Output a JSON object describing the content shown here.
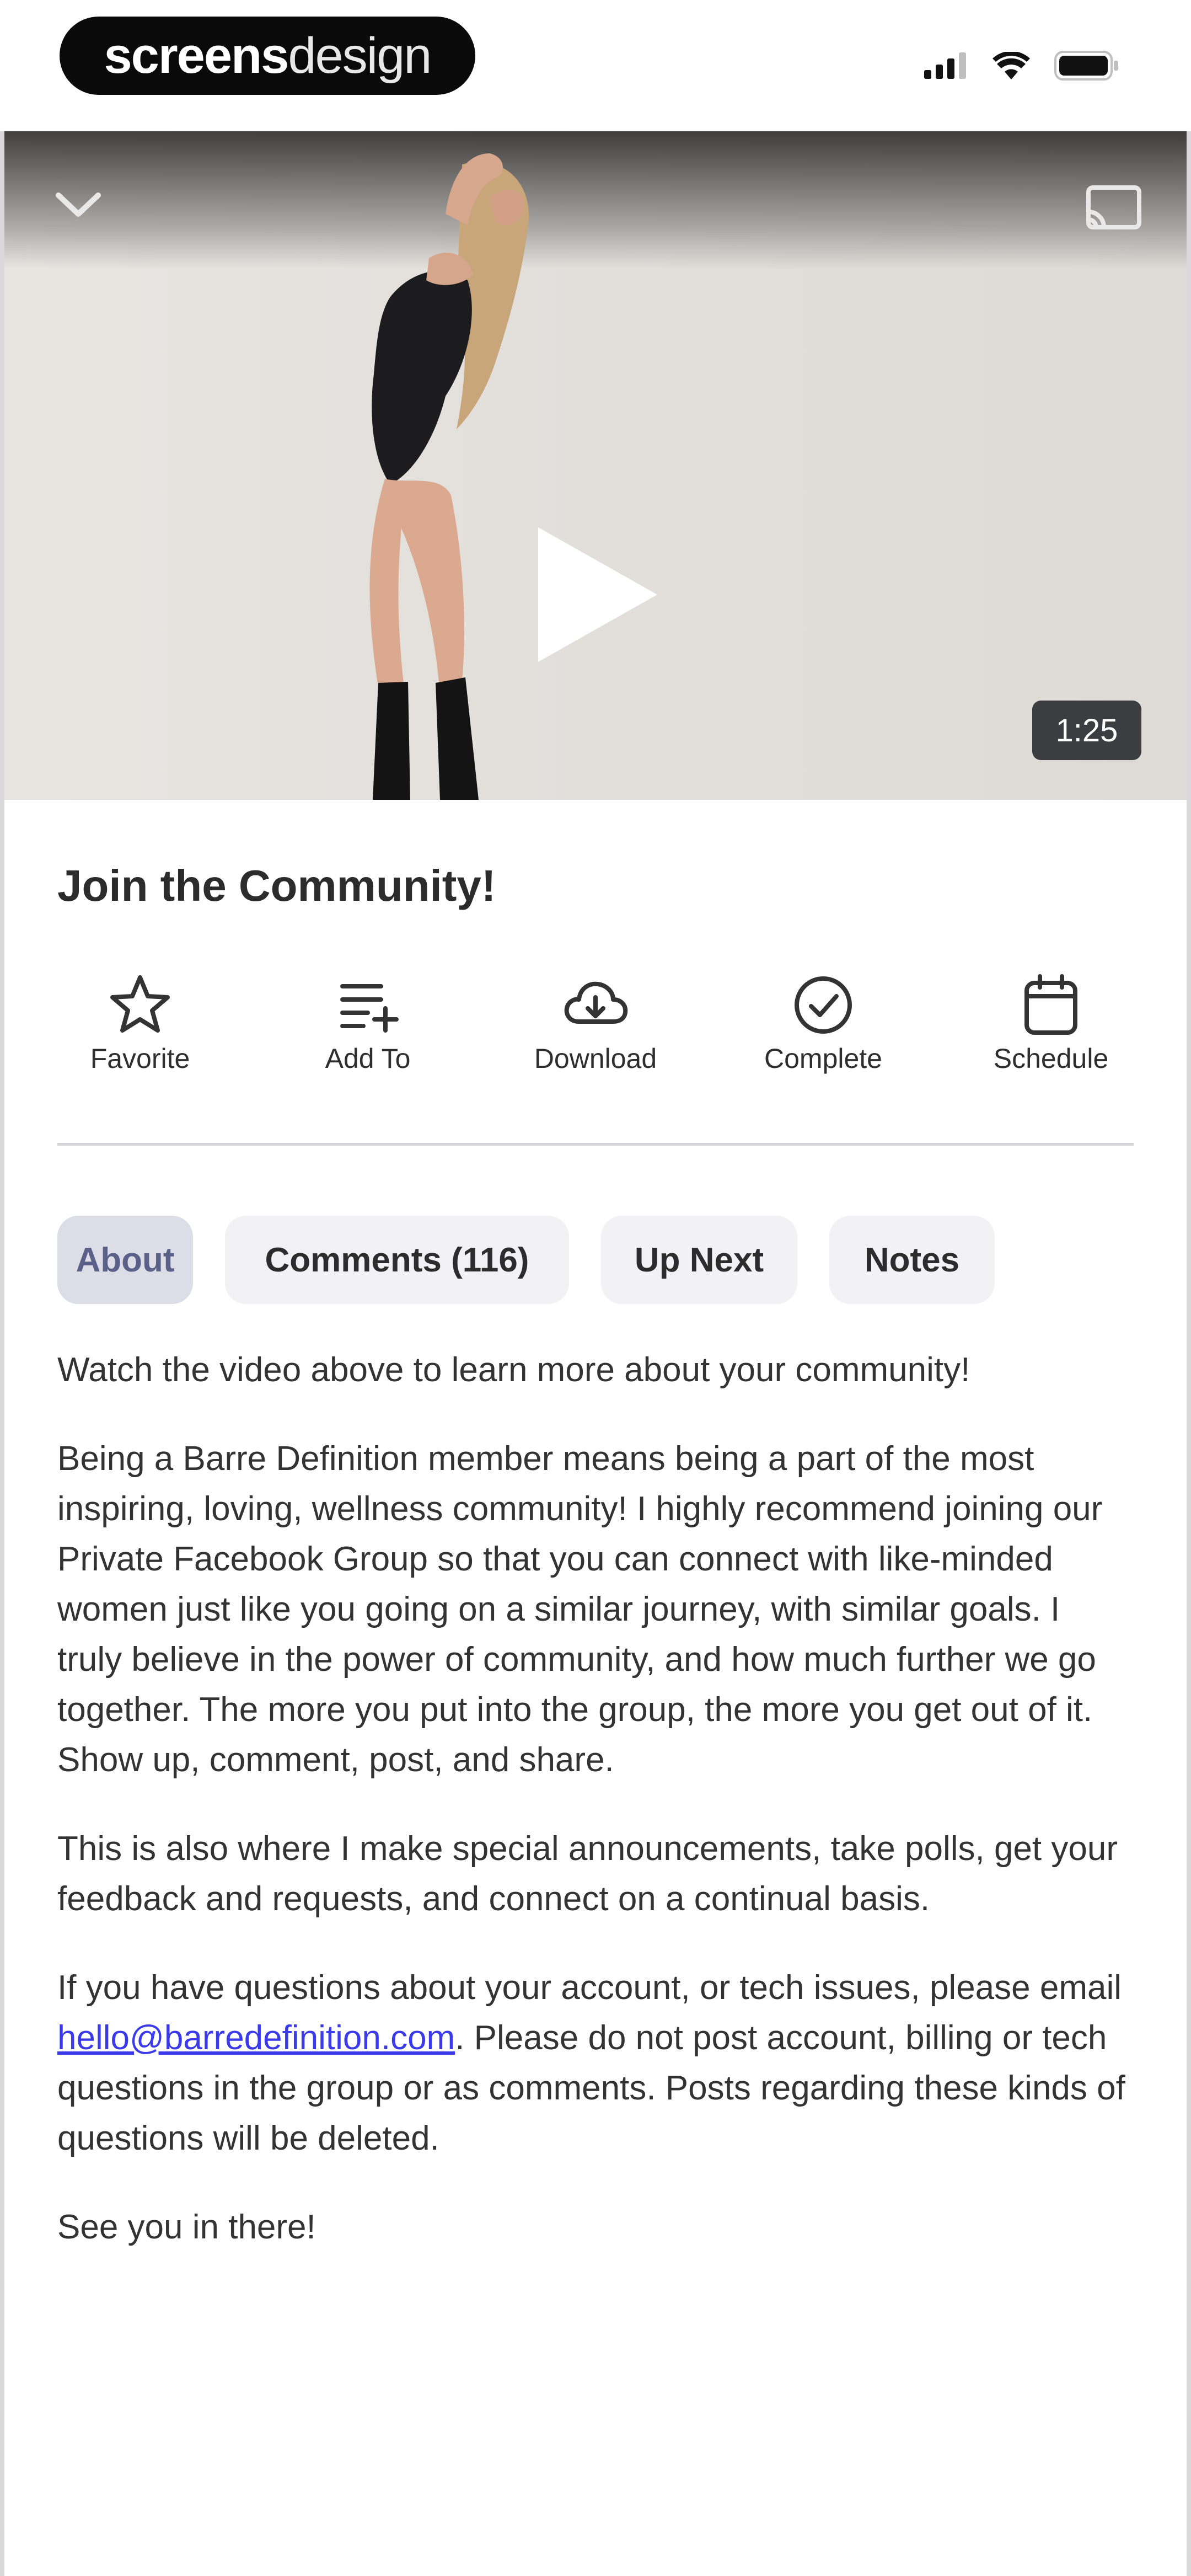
{
  "status_bar": {
    "brand_bold": "screens",
    "brand_light": "design",
    "signal_icon": "cellular-signal-icon",
    "wifi_icon": "wifi-icon",
    "battery_icon": "battery-icon"
  },
  "video": {
    "collapse_icon": "chevron-down-icon",
    "cast_icon": "cast-icon",
    "play_icon": "play-icon",
    "duration": "1:25"
  },
  "title": "Join the Community!",
  "actions": [
    {
      "label": "Favorite",
      "icon": "star-icon"
    },
    {
      "label": "Add To",
      "icon": "playlist-add-icon"
    },
    {
      "label": "Download",
      "icon": "cloud-download-icon"
    },
    {
      "label": "Complete",
      "icon": "check-circle-icon"
    },
    {
      "label": "Schedule",
      "icon": "calendar-icon"
    }
  ],
  "tabs": [
    {
      "label": "About",
      "active": true
    },
    {
      "label": "Comments (116)",
      "active": false
    },
    {
      "label": "Up Next",
      "active": false
    },
    {
      "label": "Notes",
      "active": false
    }
  ],
  "about": {
    "p1": "Watch the video above to learn more about your community!",
    "p2": "Being a Barre Definition member means being a part of the most inspiring, loving, wellness community! I highly recommend joining our Private Facebook Group so that you can connect with like-minded women just like you going on a similar journey, with similar goals. I truly believe in the power of community, and how much further we go together. The more you put into the group, the more you get out of it. Show up, comment, post, and share.",
    "p3": "This is also where I make special announcements, take polls, get your feedback and requests, and connect on a continual basis.",
    "p4_before": "If you have questions about your account, or tech issues, please email ",
    "p4_email": "hello@barredefinition.com",
    "p4_after": ". Please do not post account, billing or tech questions in the group or as comments. Posts regarding these kinds of questions will be deleted.",
    "p5": "See you in there!"
  },
  "colors": {
    "accent_tab_bg": "#dcdde6",
    "accent_tab_text": "#5b6088",
    "link": "#3a3aea",
    "badge_bg": "#3c3d41"
  }
}
